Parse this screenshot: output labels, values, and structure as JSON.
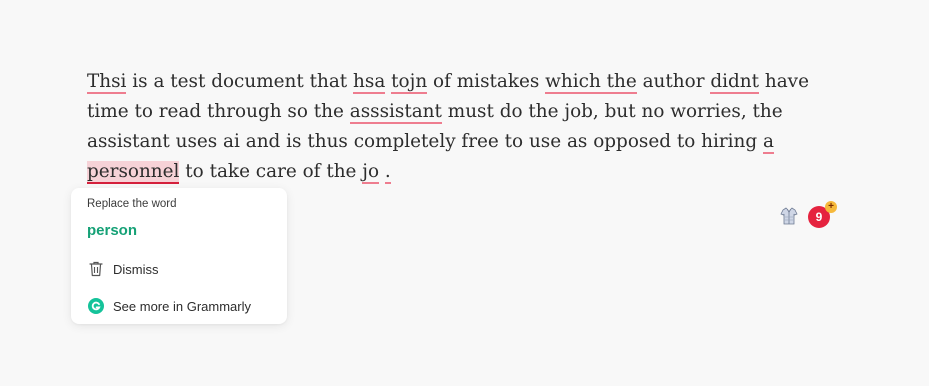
{
  "document": {
    "segments": [
      {
        "text": "Thsi",
        "error": true
      },
      {
        "text": " is a test document that "
      },
      {
        "text": "hsa",
        "error": true
      },
      {
        "text": " "
      },
      {
        "text": "tojn",
        "error": true
      },
      {
        "text": " of mistakes "
      },
      {
        "text": "which the",
        "error": true
      },
      {
        "text": " author "
      },
      {
        "text": "didnt",
        "error": true
      },
      {
        "text": " have time to read through so the "
      },
      {
        "text": "asssistant",
        "error": true
      },
      {
        "text": " must do the job, but no worries, the assistant uses ai and is thus completely free to use as opposed to hiring "
      },
      {
        "text": "a",
        "error": true
      },
      {
        "text": " "
      },
      {
        "text": "personnel",
        "error": true,
        "active": true
      },
      {
        "text": " to take care of the "
      },
      {
        "text": "jo",
        "error": true
      },
      {
        "text": " "
      },
      {
        "text": ".",
        "error": true
      }
    ]
  },
  "suggestion_card": {
    "title": "Replace the word",
    "suggestion": "person",
    "dismiss_label": "Dismiss",
    "more_label": "See more in Grammarly"
  },
  "badge": {
    "count": "9",
    "plus": "+"
  },
  "colors": {
    "error_underline": "#ee7d8f",
    "active_underline": "#d6213d",
    "active_highlight": "#f6d2d7",
    "suggestion_green": "#15a176",
    "badge_red": "#e5233f",
    "grammarly_green": "#15c39a"
  },
  "icons": {
    "extension": "shirt-icon",
    "dismiss": "trash-icon",
    "more": "grammarly-logo-icon"
  }
}
